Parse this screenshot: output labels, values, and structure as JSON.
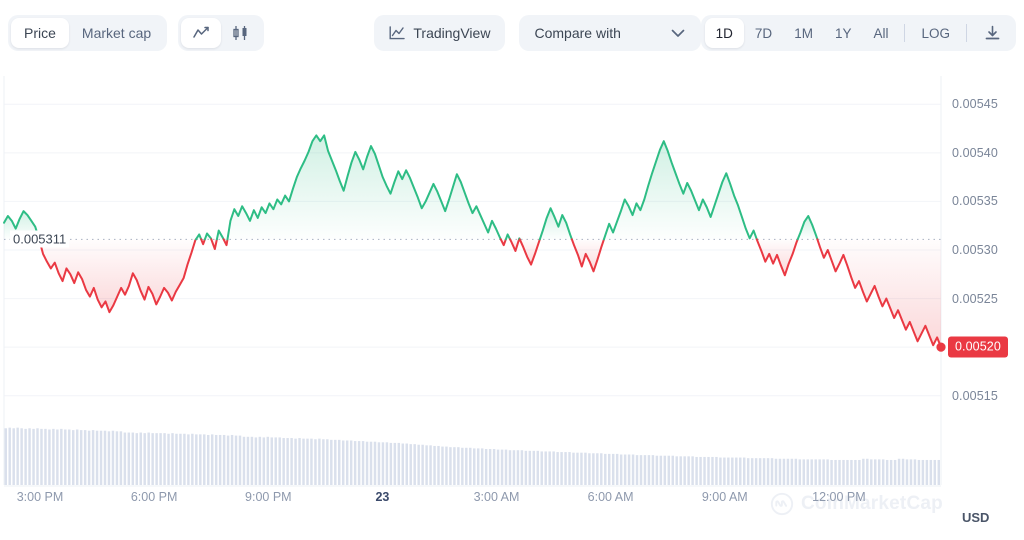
{
  "toolbar": {
    "metric_tabs": [
      {
        "label": "Price",
        "active": true
      },
      {
        "label": "Market cap",
        "active": false
      }
    ],
    "chart_type_icons": [
      {
        "name": "line-chart-icon",
        "active": true
      },
      {
        "name": "candlestick-chart-icon",
        "active": false
      }
    ],
    "tradingview_label": "TradingView",
    "tradingview_icon": "line-chart-icon",
    "compare_label": "Compare with",
    "compare_icon": "chevron-down-icon",
    "ranges": [
      {
        "label": "1D",
        "active": true
      },
      {
        "label": "7D",
        "active": false
      },
      {
        "label": "1M",
        "active": false
      },
      {
        "label": "1Y",
        "active": false
      },
      {
        "label": "All",
        "active": false
      }
    ],
    "log_label": "LOG",
    "download_icon": "download-icon"
  },
  "chart_data": {
    "type": "area",
    "title": "",
    "xlabel": "",
    "ylabel": "USD",
    "currency": "USD",
    "ylim": [
      0.005125,
      0.005475
    ],
    "y_ticks": [
      "0.00545",
      "0.00540",
      "0.00535",
      "0.00530",
      "0.00525",
      "0.00520",
      "0.00515"
    ],
    "y_tick_values": [
      0.00545,
      0.0054,
      0.00535,
      0.0053,
      0.00525,
      0.0052,
      0.00515
    ],
    "x_ticks": [
      "3:00 PM",
      "6:00 PM",
      "9:00 PM",
      "23",
      "3:00 AM",
      "6:00 AM",
      "9:00 AM",
      "12:00 PM"
    ],
    "x_tick_bold_index": 3,
    "grid": true,
    "legend": "none",
    "open_price_label": "0.005311",
    "open_price_value": 0.005311,
    "current_price_label": "0.00520",
    "current_price_value": 0.0052,
    "colors": {
      "up": "#2ebd85",
      "down": "#ea3943",
      "volume": "#ced5e6",
      "grid": "#f2f4f8",
      "axis_text": "#8e99ad"
    },
    "price_series": [
      0.005328,
      0.005335,
      0.00533,
      0.005322,
      0.005332,
      0.00534,
      0.005336,
      0.00533,
      0.005324,
      0.005311,
      0.005296,
      0.005288,
      0.005281,
      0.005287,
      0.005276,
      0.005268,
      0.005281,
      0.005275,
      0.005266,
      0.005277,
      0.00527,
      0.005259,
      0.005252,
      0.005261,
      0.005249,
      0.005241,
      0.005247,
      0.005236,
      0.005243,
      0.005252,
      0.005261,
      0.005254,
      0.005263,
      0.005276,
      0.005269,
      0.005258,
      0.005249,
      0.005262,
      0.005255,
      0.005244,
      0.005252,
      0.005261,
      0.005256,
      0.005248,
      0.005257,
      0.005264,
      0.005271,
      0.005285,
      0.005297,
      0.00531,
      0.005316,
      0.005306,
      0.005317,
      0.005312,
      0.005301,
      0.00532,
      0.005313,
      0.005305,
      0.00533,
      0.005342,
      0.005335,
      0.005345,
      0.005338,
      0.00533,
      0.005341,
      0.005333,
      0.005344,
      0.005338,
      0.005348,
      0.005342,
      0.005352,
      0.005347,
      0.005356,
      0.00535,
      0.005363,
      0.005375,
      0.005384,
      0.005392,
      0.005401,
      0.005412,
      0.005418,
      0.005412,
      0.005418,
      0.005402,
      0.005392,
      0.005382,
      0.005371,
      0.005361,
      0.005376,
      0.00539,
      0.005401,
      0.005393,
      0.005383,
      0.005396,
      0.005407,
      0.005399,
      0.005387,
      0.005375,
      0.005366,
      0.005358,
      0.00537,
      0.005381,
      0.005373,
      0.005382,
      0.005374,
      0.005364,
      0.005354,
      0.005343,
      0.00535,
      0.005359,
      0.005368,
      0.00536,
      0.00535,
      0.00534,
      0.005352,
      0.005365,
      0.005378,
      0.00537,
      0.005359,
      0.005348,
      0.005338,
      0.005345,
      0.005336,
      0.005327,
      0.005318,
      0.00533,
      0.005322,
      0.005313,
      0.005305,
      0.005316,
      0.005308,
      0.005299,
      0.005312,
      0.005303,
      0.005293,
      0.005285,
      0.005296,
      0.005308,
      0.00532,
      0.005333,
      0.005343,
      0.005334,
      0.005324,
      0.005336,
      0.005328,
      0.005316,
      0.005305,
      0.005295,
      0.005283,
      0.005296,
      0.005288,
      0.005278,
      0.00529,
      0.005303,
      0.005315,
      0.005327,
      0.005318,
      0.005329,
      0.00534,
      0.005352,
      0.005345,
      0.005336,
      0.005348,
      0.005341,
      0.005352,
      0.005366,
      0.005379,
      0.005391,
      0.005403,
      0.005412,
      0.005402,
      0.00539,
      0.005379,
      0.005368,
      0.005358,
      0.005369,
      0.005361,
      0.005351,
      0.005341,
      0.005352,
      0.005344,
      0.005334,
      0.005346,
      0.005358,
      0.00537,
      0.005379,
      0.005368,
      0.005356,
      0.005346,
      0.005334,
      0.005322,
      0.005312,
      0.00532,
      0.005309,
      0.005299,
      0.005288,
      0.005296,
      0.005286,
      0.005295,
      0.005284,
      0.005274,
      0.005286,
      0.005296,
      0.005308,
      0.005318,
      0.005329,
      0.005335,
      0.005326,
      0.005315,
      0.005303,
      0.005292,
      0.0053,
      0.005289,
      0.005278,
      0.005286,
      0.005295,
      0.005284,
      0.005272,
      0.005261,
      0.005268,
      0.005257,
      0.005247,
      0.005255,
      0.005263,
      0.005252,
      0.005242,
      0.00525,
      0.00524,
      0.00523,
      0.005238,
      0.005228,
      0.005218,
      0.005226,
      0.005216,
      0.005206,
      0.005214,
      0.005222,
      0.005212,
      0.005202,
      0.00521,
      0.0052
    ],
    "volume_series": [
      0.93,
      0.94,
      0.93,
      0.94,
      0.93,
      0.92,
      0.93,
      0.92,
      0.93,
      0.92,
      0.92,
      0.91,
      0.92,
      0.91,
      0.92,
      0.91,
      0.91,
      0.9,
      0.91,
      0.9,
      0.9,
      0.89,
      0.9,
      0.89,
      0.89,
      0.89,
      0.88,
      0.89,
      0.88,
      0.88,
      0.86,
      0.86,
      0.86,
      0.85,
      0.86,
      0.85,
      0.86,
      0.85,
      0.85,
      0.85,
      0.85,
      0.84,
      0.85,
      0.84,
      0.84,
      0.84,
      0.83,
      0.84,
      0.83,
      0.83,
      0.83,
      0.82,
      0.83,
      0.82,
      0.82,
      0.82,
      0.81,
      0.82,
      0.81,
      0.81,
      0.79,
      0.79,
      0.79,
      0.78,
      0.79,
      0.78,
      0.79,
      0.78,
      0.78,
      0.78,
      0.77,
      0.77,
      0.77,
      0.76,
      0.77,
      0.76,
      0.76,
      0.76,
      0.75,
      0.76,
      0.75,
      0.75,
      0.74,
      0.74,
      0.74,
      0.73,
      0.73,
      0.73,
      0.72,
      0.72,
      0.72,
      0.71,
      0.71,
      0.71,
      0.7,
      0.7,
      0.7,
      0.69,
      0.69,
      0.69,
      0.68,
      0.68,
      0.67,
      0.67,
      0.66,
      0.66,
      0.65,
      0.65,
      0.64,
      0.64,
      0.63,
      0.63,
      0.62,
      0.62,
      0.62,
      0.61,
      0.61,
      0.61,
      0.6,
      0.6,
      0.6,
      0.59,
      0.59,
      0.59,
      0.58,
      0.58,
      0.58,
      0.57,
      0.57,
      0.57,
      0.57,
      0.56,
      0.56,
      0.56,
      0.56,
      0.55,
      0.55,
      0.55,
      0.55,
      0.54,
      0.54,
      0.54,
      0.54,
      0.53,
      0.53,
      0.53,
      0.53,
      0.52,
      0.52,
      0.52,
      0.52,
      0.51,
      0.51,
      0.51,
      0.51,
      0.5,
      0.5,
      0.5,
      0.5,
      0.49,
      0.49,
      0.49,
      0.49,
      0.49,
      0.48,
      0.48,
      0.48,
      0.48,
      0.48,
      0.47,
      0.47,
      0.47,
      0.47,
      0.47,
      0.46,
      0.46,
      0.46,
      0.46,
      0.46,
      0.46,
      0.45,
      0.45,
      0.45,
      0.45,
      0.45,
      0.45,
      0.45,
      0.44,
      0.44,
      0.44,
      0.44,
      0.44,
      0.44,
      0.44,
      0.43,
      0.43,
      0.43,
      0.43,
      0.43,
      0.43,
      0.42,
      0.42,
      0.42,
      0.42,
      0.42,
      0.42,
      0.42,
      0.42,
      0.41,
      0.41,
      0.41,
      0.41,
      0.41,
      0.41,
      0.41,
      0.41,
      0.43,
      0.43,
      0.42,
      0.42,
      0.42,
      0.42,
      0.41,
      0.41,
      0.41,
      0.43,
      0.43,
      0.42,
      0.42,
      0.42,
      0.41,
      0.41,
      0.41,
      0.41,
      0.41,
      0.41
    ]
  },
  "watermark": {
    "text": "CoinMarketCap",
    "icon": "coinmarketcap-logo-icon"
  }
}
